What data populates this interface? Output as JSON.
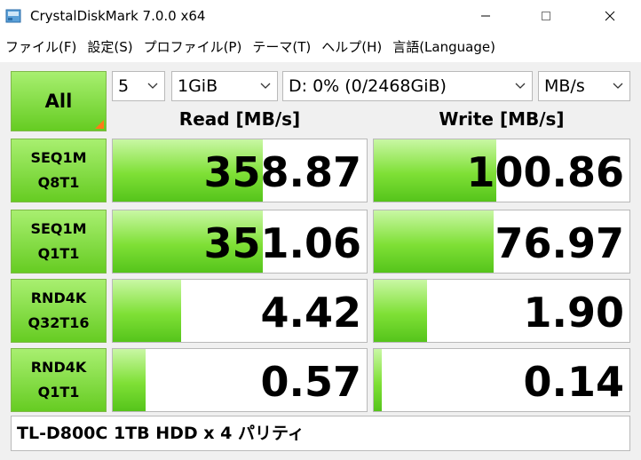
{
  "window": {
    "title": "CrystalDiskMark 7.0.0 x64"
  },
  "menu": [
    {
      "label": "ファイル(F)"
    },
    {
      "label": "設定(S)"
    },
    {
      "label": "プロファイル(P)"
    },
    {
      "label": "テーマ(T)"
    },
    {
      "label": "ヘルプ(H)"
    },
    {
      "label": "言語(Language)"
    }
  ],
  "controls": {
    "all_label": "All",
    "count": "5",
    "size": "1GiB",
    "drive": "D: 0% (0/2468GiB)",
    "unit": "MB/s"
  },
  "headers": {
    "read": "Read [MB/s]",
    "write": "Write [MB/s]"
  },
  "tests": [
    {
      "line1": "SEQ1M",
      "line2": "Q8T1",
      "read": "358.87",
      "write": "100.86",
      "read_fill": 0.59,
      "write_fill": 0.48
    },
    {
      "line1": "SEQ1M",
      "line2": "Q1T1",
      "read": "351.06",
      "write": "76.97",
      "read_fill": 0.59,
      "write_fill": 0.47
    },
    {
      "line1": "RND4K",
      "line2": "Q32T16",
      "read": "4.42",
      "write": "1.90",
      "read_fill": 0.27,
      "write_fill": 0.21
    },
    {
      "line1": "RND4K",
      "line2": "Q1T1",
      "read": "0.57",
      "write": "0.14",
      "read_fill": 0.13,
      "write_fill": 0.03
    }
  ],
  "comment": "TL-D800C 1TB HDD x 4 パリティ",
  "colors": {
    "bar_green": "#7fe036",
    "button_green": "#66cc22",
    "corner_orange": "#ff7a1a"
  },
  "icons": {
    "app": "crystaldiskmark-icon",
    "minimize": "minimize-icon",
    "maximize": "maximize-icon",
    "close": "close-icon",
    "dropdown": "chevron-down-icon"
  }
}
